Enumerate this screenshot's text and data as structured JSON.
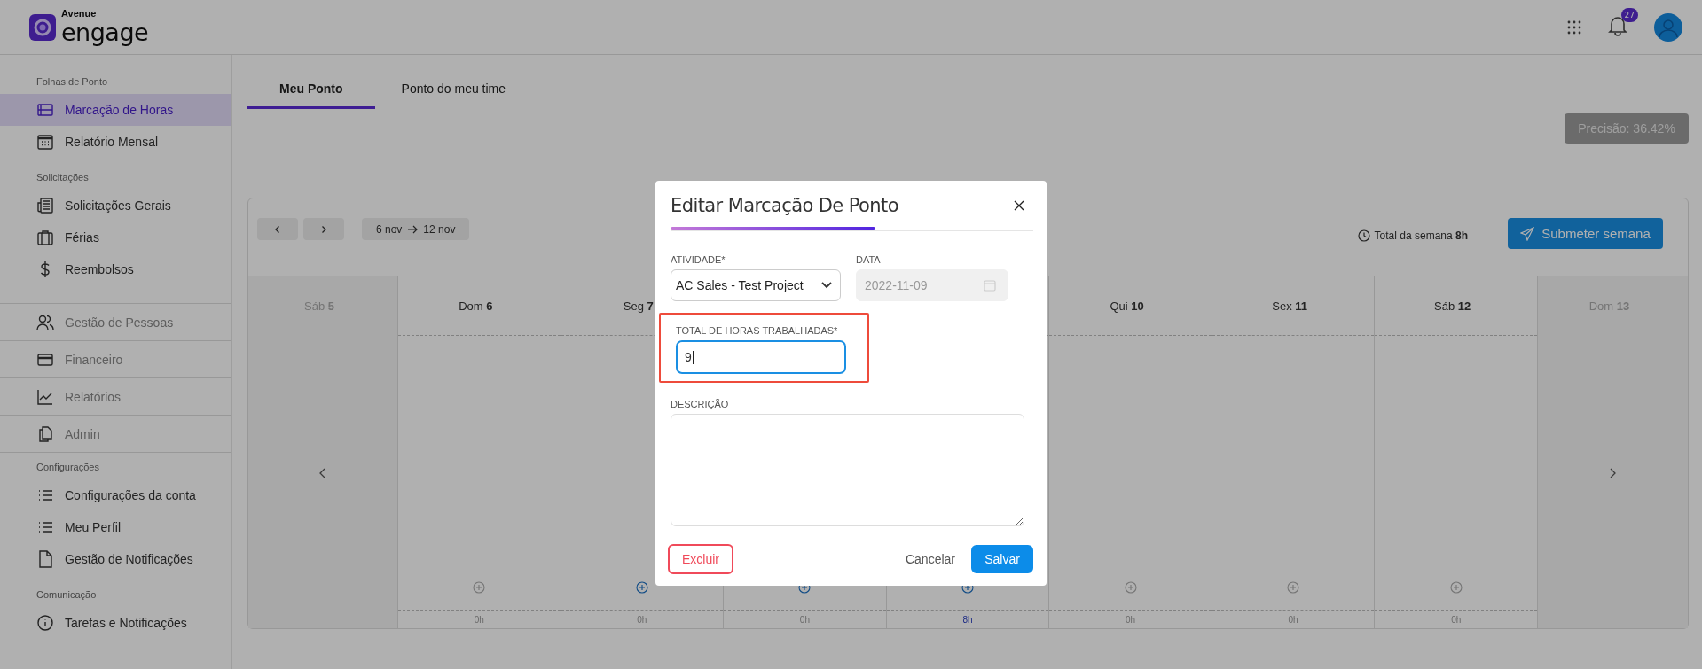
{
  "header": {
    "logo_top": "Avenue",
    "logo_main": "engage",
    "notifications": "27"
  },
  "sidebar": {
    "sections": [
      {
        "title": "Folhas de Ponto",
        "divided": false,
        "items": [
          {
            "label": "Marcação de Horas",
            "selected": true,
            "disabled": false
          },
          {
            "label": "Relatório Mensal",
            "selected": false,
            "disabled": false
          }
        ]
      },
      {
        "title": "Solicitações",
        "divided": false,
        "items": [
          {
            "label": "Solicitações Gerais",
            "selected": false,
            "disabled": false
          },
          {
            "label": "Férias",
            "selected": false,
            "disabled": false
          },
          {
            "label": "Reembolsos",
            "selected": false,
            "disabled": false
          }
        ]
      },
      {
        "divided": true,
        "items": [
          {
            "label": "Gestão de Pessoas",
            "selected": false,
            "disabled": true
          },
          {
            "label": "Financeiro",
            "selected": false,
            "disabled": true
          },
          {
            "label": "Relatórios",
            "selected": false,
            "disabled": true
          },
          {
            "label": "Admin",
            "selected": false,
            "disabled": true
          }
        ]
      },
      {
        "title": "Configurações",
        "divided": false,
        "items": [
          {
            "label": "Configurações da conta",
            "selected": false,
            "disabled": false
          },
          {
            "label": "Meu Perfil",
            "selected": false,
            "disabled": false
          },
          {
            "label": "Gestão de Notificações",
            "selected": false,
            "disabled": false
          }
        ]
      },
      {
        "title": "Comunicação",
        "divided": false,
        "items": [
          {
            "label": "Tarefas e Notificações",
            "selected": false,
            "disabled": false
          }
        ]
      }
    ]
  },
  "tabs": [
    {
      "label": "Meu Ponto",
      "selected": true
    },
    {
      "label": "Ponto do meu time",
      "selected": false
    }
  ],
  "precision": "Precisão: 36.42%",
  "week": {
    "start": "6 nov",
    "end": "12 nov",
    "total": "Total da semana **8h**",
    "submit": "Submeter semana"
  },
  "days": [
    {
      "weekday": "Sáb",
      "day": "5",
      "outside": true
    },
    {
      "weekday": "Dom",
      "day": "6",
      "outside": false,
      "can_add": false,
      "hours": "0h",
      "logged": false
    },
    {
      "weekday": "Seg",
      "day": "7",
      "outside": false,
      "can_add": true,
      "hours": "0h",
      "logged": false
    },
    {
      "outside": false,
      "can_add": true,
      "hours": "0h",
      "logged": false
    },
    {
      "outside": false,
      "can_add": true,
      "hours": "8h",
      "logged": true
    },
    {
      "weekday": "Qui",
      "day": "10",
      "outside": false,
      "can_add": false,
      "hours": "0h",
      "logged": false
    },
    {
      "weekday": "Sex",
      "day": "11",
      "outside": false,
      "can_add": false,
      "hours": "0h",
      "logged": false
    },
    {
      "weekday": "Sáb",
      "day": "12",
      "outside": false,
      "can_add": false,
      "hours": "0h",
      "logged": false
    },
    {
      "weekday": "Dom",
      "day": "13",
      "outside": true
    }
  ],
  "modal": {
    "title": "Editar Marcação De Ponto",
    "activity": {
      "label": "ATIVIDADE*",
      "value": "AC Sales - Test Project"
    },
    "date": {
      "label": "DATA",
      "value": "2022-11-09",
      "disabled": true
    },
    "hours": {
      "label": "TOTAL DE HORAS TRABALHADAS*",
      "value": "9",
      "highlighted": true
    },
    "description": {
      "label": "DESCRIÇÃO"
    },
    "delete": "Excluir",
    "cancel": "Cancelar",
    "save": "Salvar"
  }
}
